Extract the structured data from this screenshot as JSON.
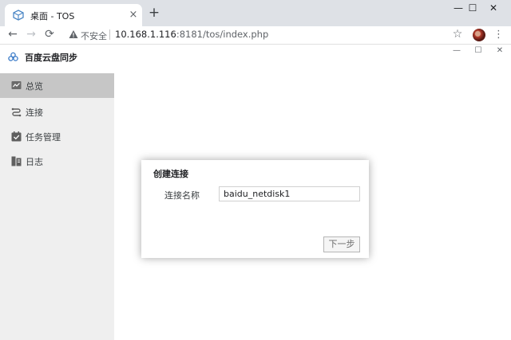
{
  "browser": {
    "tab_title": "桌面 - TOS",
    "tab_close": "×",
    "new_tab": "+",
    "window_controls": {
      "minimize": "—",
      "maximize": "☐",
      "close": "✕"
    },
    "nav": {
      "back": "←",
      "forward": "→",
      "reload": "⟳"
    },
    "security_label": "不安全",
    "url_host": "10.168.1.116",
    "url_rest": ":8181/tos/index.php",
    "bookmark_star": "☆",
    "menu": "⋮"
  },
  "app": {
    "title": "百度云盘同步",
    "window_controls": {
      "minimize": "—",
      "maximize": "☐",
      "close": "✕"
    },
    "sidebar": {
      "items": [
        {
          "label": "总览",
          "icon": "chart-icon",
          "active": true
        },
        {
          "label": "连接",
          "icon": "link-icon",
          "active": false
        },
        {
          "label": "任务管理",
          "icon": "calendar-check-icon",
          "active": false
        },
        {
          "label": "日志",
          "icon": "document-icon",
          "active": false
        }
      ]
    }
  },
  "dialog": {
    "title": "创建连接",
    "field_label": "连接名称",
    "field_value": "baidu_netdisk1",
    "next_button": "下一步"
  },
  "colors": {
    "sidebar_bg": "#efefef",
    "active_item_bg": "#c6c6c6",
    "tabstrip_bg": "#dee1e6"
  }
}
